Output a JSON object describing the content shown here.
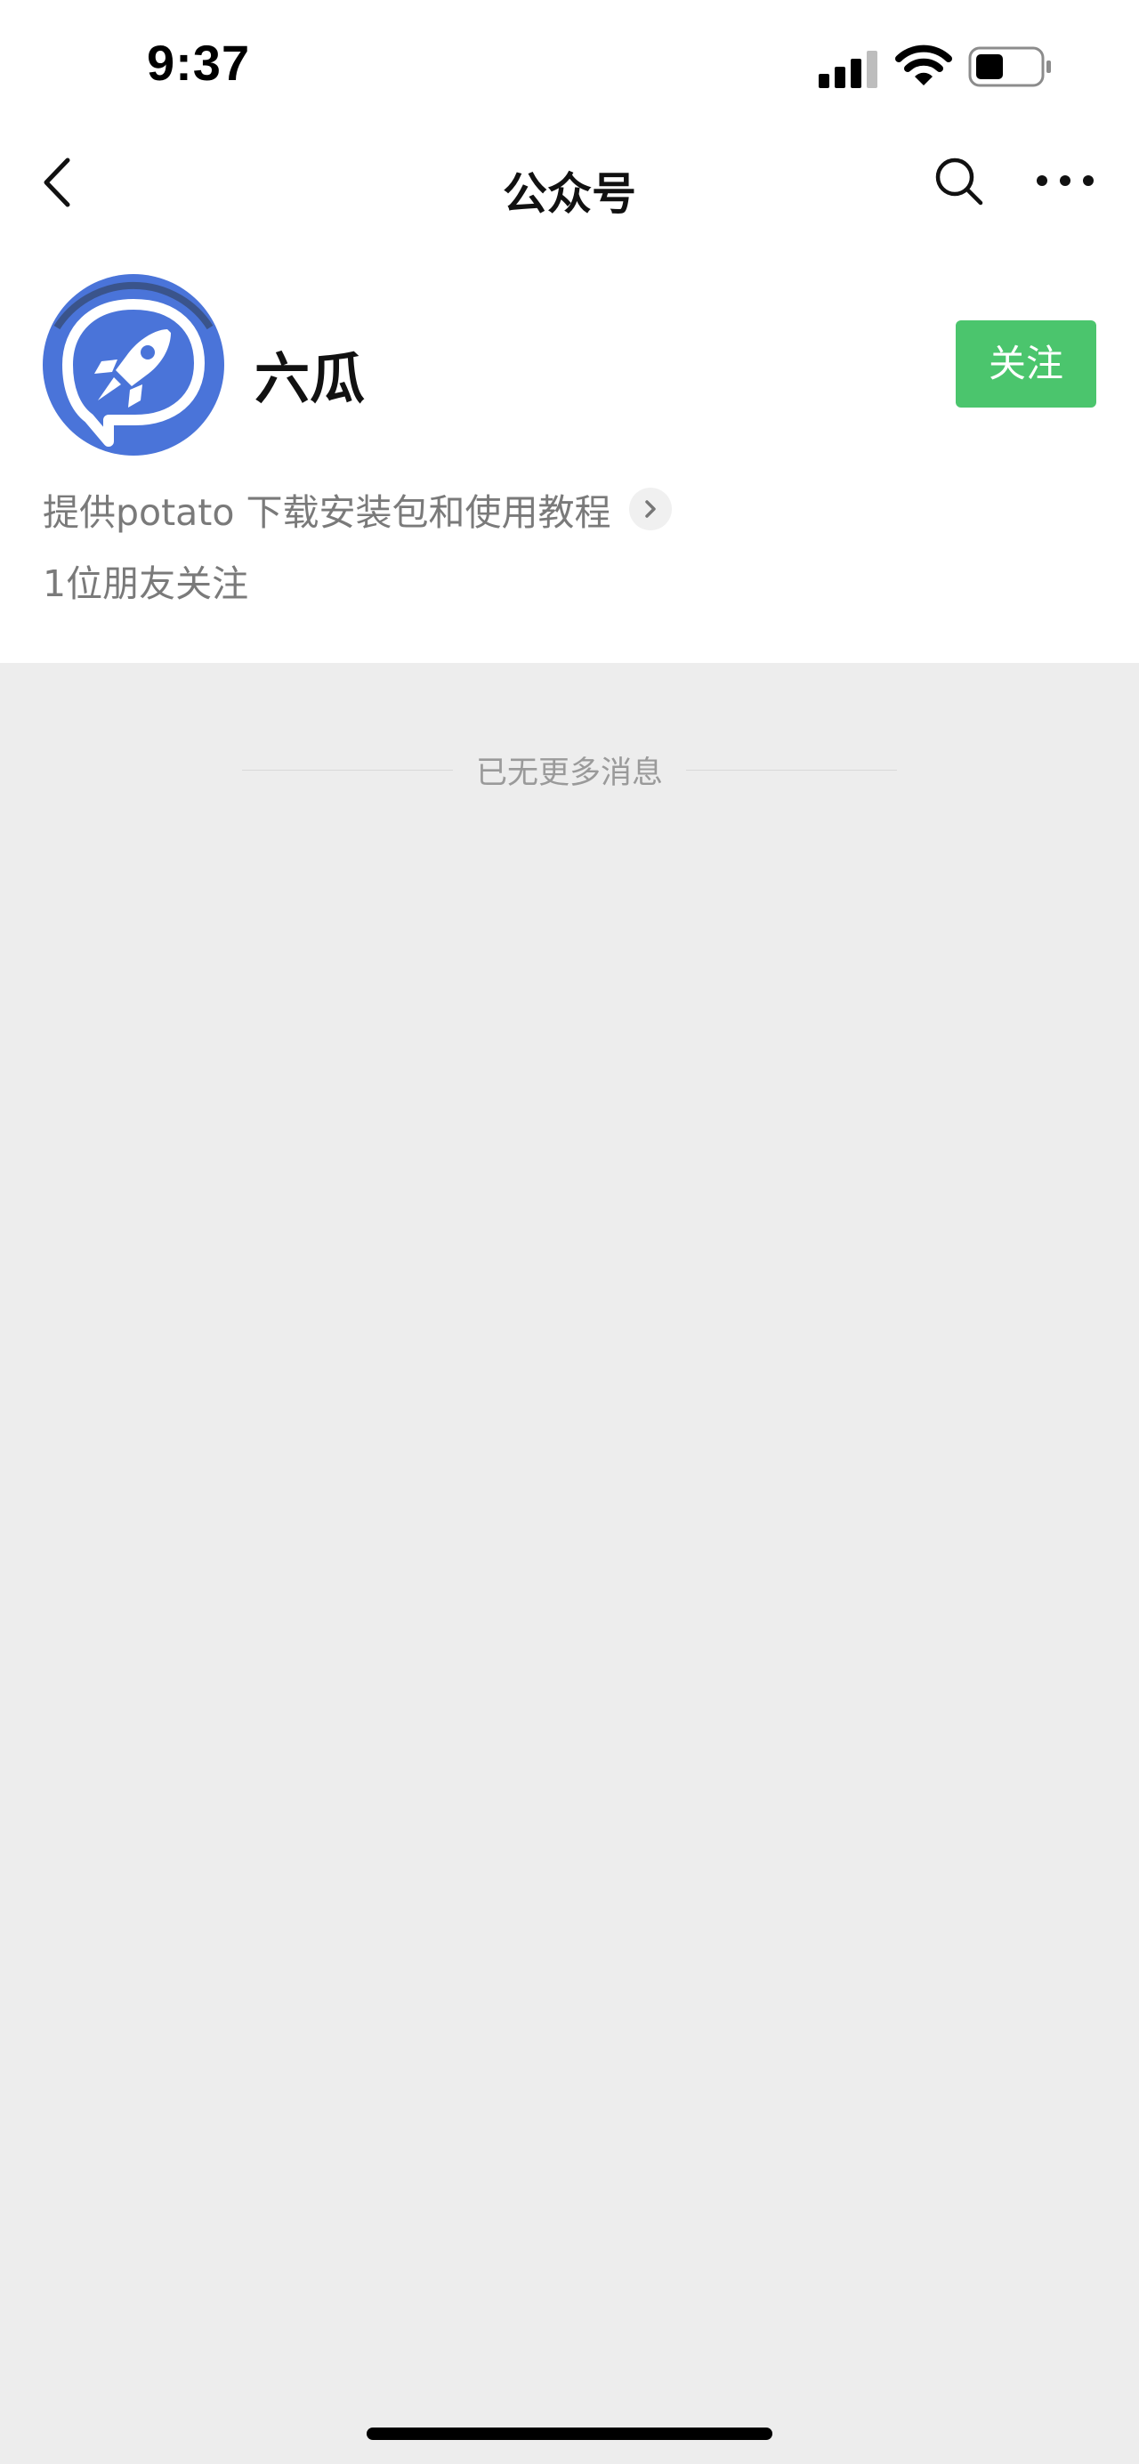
{
  "status_bar": {
    "time": "9:37",
    "icons": [
      "signal-icon",
      "wifi-icon",
      "battery-icon"
    ]
  },
  "nav": {
    "title": "公众号",
    "icons": [
      "back-icon",
      "search-icon",
      "more-icon"
    ]
  },
  "profile": {
    "name": "六瓜",
    "follow_label": "关注",
    "description": "提供potato 下载安装包和使用教程",
    "friends_follow": "1位朋友关注",
    "avatar_icon": "rocket-chat-logo-icon"
  },
  "messages": {
    "end_text": "已无更多消息"
  },
  "colors": {
    "follow_button": "#4bc56d",
    "avatar_blue": "#4a74d9",
    "background": "#ededed"
  }
}
